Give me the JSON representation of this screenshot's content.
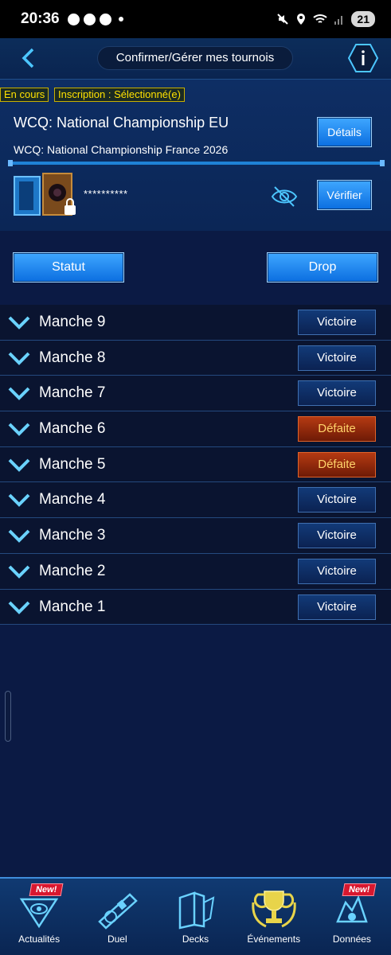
{
  "status_bar": {
    "time": "20:36",
    "battery": "21"
  },
  "header": {
    "title": "Confirmer/Gérer mes tournois"
  },
  "tournament": {
    "tag_status": "En cours",
    "tag_registration": "Inscription : Sélectionné(e)",
    "name": "WCQ: National Championship EU",
    "subtitle": "WCQ: National Championship France 2026",
    "details_label": "Détails",
    "deck_code": "**********",
    "verify_label": "Vérifier"
  },
  "actions": {
    "statut_label": "Statut",
    "drop_label": "Drop"
  },
  "rounds": [
    {
      "label": "Manche 9",
      "result": "Victoire"
    },
    {
      "label": "Manche 8",
      "result": "Victoire"
    },
    {
      "label": "Manche 7",
      "result": "Victoire"
    },
    {
      "label": "Manche 6",
      "result": "Défaite"
    },
    {
      "label": "Manche 5",
      "result": "Défaite"
    },
    {
      "label": "Manche 4",
      "result": "Victoire"
    },
    {
      "label": "Manche 3",
      "result": "Victoire"
    },
    {
      "label": "Manche 2",
      "result": "Victoire"
    },
    {
      "label": "Manche 1",
      "result": "Victoire"
    }
  ],
  "bottom_nav": [
    {
      "label": "Actualités",
      "badge": "New!"
    },
    {
      "label": "Duel"
    },
    {
      "label": "Decks"
    },
    {
      "label": "Événements"
    },
    {
      "label": "Données",
      "badge": "New!"
    }
  ],
  "colors": {
    "accent": "#1f82d6",
    "win": "#123a78",
    "loss": "#b53a12"
  }
}
